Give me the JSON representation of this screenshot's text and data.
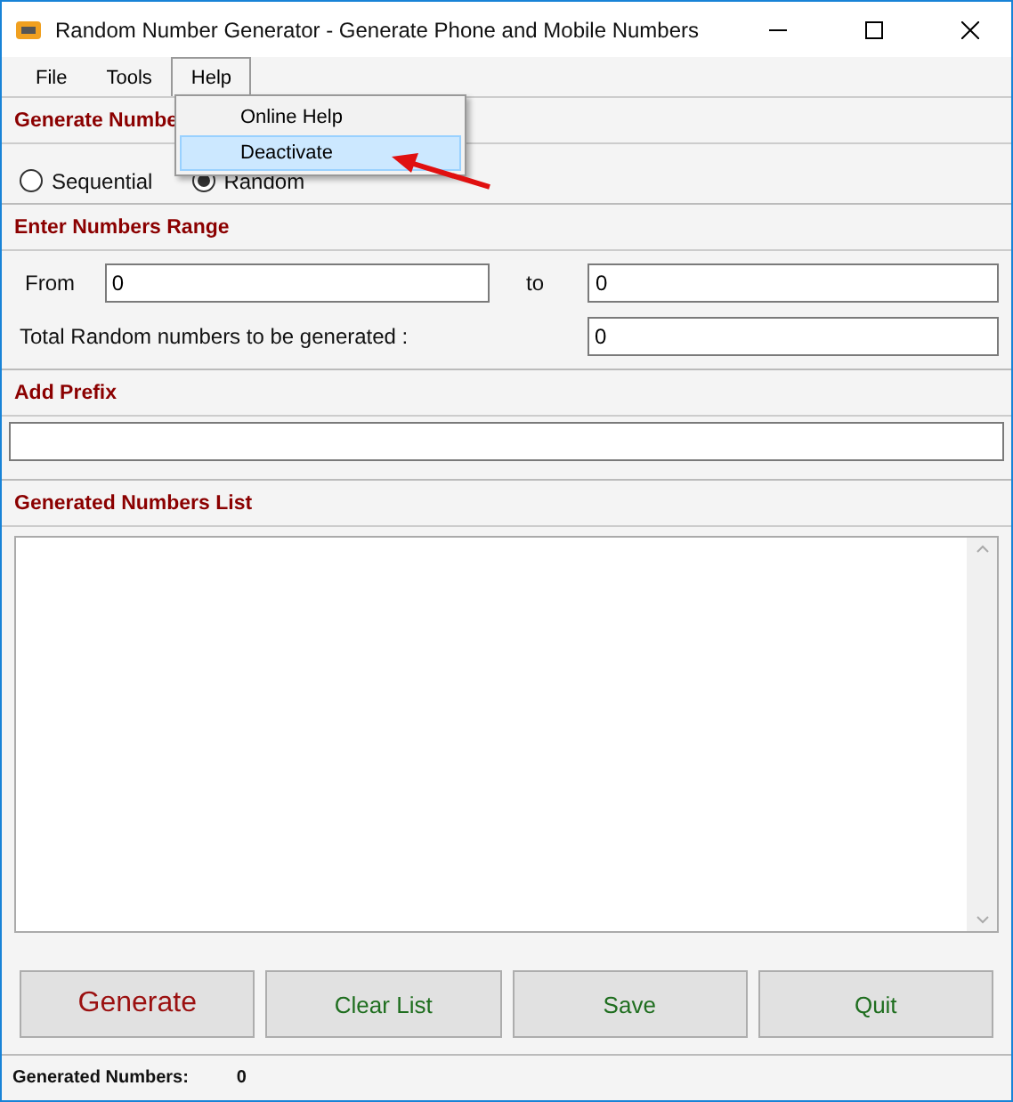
{
  "window": {
    "title": "Random Number Generator - Generate Phone and Mobile Numbers"
  },
  "menu": [
    {
      "label": "File",
      "selected": false
    },
    {
      "label": "Tools",
      "selected": false
    },
    {
      "label": "Help",
      "selected": true
    }
  ],
  "open_menu": {
    "items": [
      {
        "label": "Online Help",
        "selected": false
      },
      {
        "label": "Deactivate",
        "selected": true
      }
    ]
  },
  "generate_section": {
    "heading": "Generate Numbe",
    "options": [
      {
        "label": "Sequential",
        "selected": false
      },
      {
        "label": "Random",
        "selected": true
      }
    ]
  },
  "range_section": {
    "heading": "Enter Numbers Range",
    "from_label": "From",
    "from_value": "0",
    "to_label": "to",
    "to_value": "0",
    "total_label": "Total Random numbers to be generated :",
    "total_value": "0"
  },
  "prefix_section": {
    "heading": "Add Prefix"
  },
  "list_section": {
    "heading": "Generated Numbers List"
  },
  "buttons": [
    {
      "label": "Generate",
      "kind": "primary"
    },
    {
      "label": "Clear List",
      "kind": "secondary"
    },
    {
      "label": "Save",
      "kind": "secondary"
    },
    {
      "label": "Quit",
      "kind": "secondary"
    }
  ],
  "status_bar": {
    "label": "Generated Numbers:",
    "value": "0"
  }
}
